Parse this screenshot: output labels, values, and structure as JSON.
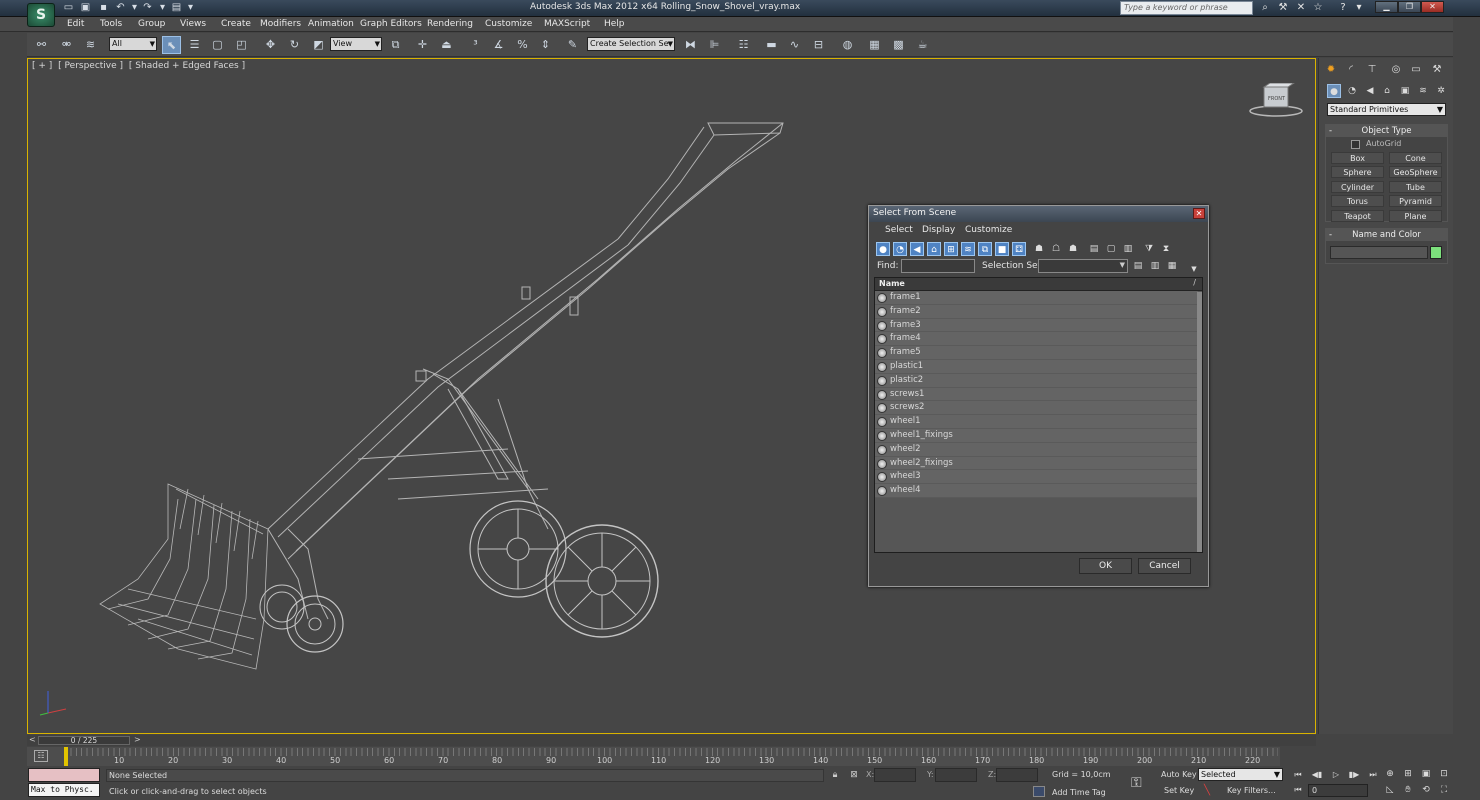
{
  "app": {
    "title": "Autodesk 3ds Max  2012 x64       Rolling_Snow_Shovel_vray.max",
    "search_placeholder": "Type a keyword or phrase",
    "logo_glyph": "S"
  },
  "menu": [
    "Edit",
    "Tools",
    "Group",
    "Views",
    "Create",
    "Modifiers",
    "Animation",
    "Graph Editors",
    "Rendering",
    "Customize",
    "MAXScript",
    "Help"
  ],
  "toolbar": {
    "selection_filter": "All",
    "ref_coord": "View",
    "named_selection": "Create Selection Se"
  },
  "viewport": {
    "labels": [
      "[ + ]",
      "[ Perspective ]",
      "[ Shaded + Edged Faces ]"
    ],
    "viewcube_label": "FRONT"
  },
  "dialog": {
    "title": "Select From Scene",
    "menu": [
      "Select",
      "Display",
      "Customize"
    ],
    "find_label": "Find:",
    "selection_set_label": "Selection Set:",
    "column_name": "Name",
    "sort_arrow": "/",
    "items": [
      "frame1",
      "frame2",
      "frame3",
      "frame4",
      "frame5",
      "plastic1",
      "plastic2",
      "screws1",
      "screws2",
      "wheel1",
      "wheel1_fixings",
      "wheel2",
      "wheel2_fixings",
      "wheel3",
      "wheel4"
    ],
    "ok_label": "OK",
    "cancel_label": "Cancel"
  },
  "command_panel": {
    "category": "Standard Primitives",
    "object_type_title": "Object Type",
    "autogrid_label": "AutoGrid",
    "buttons": [
      "Box",
      "Cone",
      "Sphere",
      "GeoSphere",
      "Cylinder",
      "Tube",
      "Torus",
      "Pyramid",
      "Teapot",
      "Plane"
    ],
    "name_color_title": "Name and Color",
    "object_color": "#7ce07c"
  },
  "timeline": {
    "slider_label": "0 / 225",
    "prev": "<",
    "next": ">",
    "ticks": [
      "10",
      "20",
      "30",
      "40",
      "50",
      "60",
      "70",
      "80",
      "90",
      "100",
      "110",
      "120",
      "130",
      "140",
      "150",
      "160",
      "170",
      "180",
      "190",
      "200",
      "210",
      "220"
    ]
  },
  "status": {
    "maxscript_label": "Max to Physc.",
    "selection_status": "None Selected",
    "prompt": "Click or click-and-drag to select objects",
    "x_label": "X:",
    "y_label": "Y:",
    "z_label": "Z:",
    "grid": "Grid = 10,0cm",
    "add_time_tag": "Add Time Tag",
    "auto_key": "Auto Key",
    "set_key": "Set Key",
    "key_mode": "Selected",
    "key_filters": "Key Filters...",
    "frame": "0"
  }
}
